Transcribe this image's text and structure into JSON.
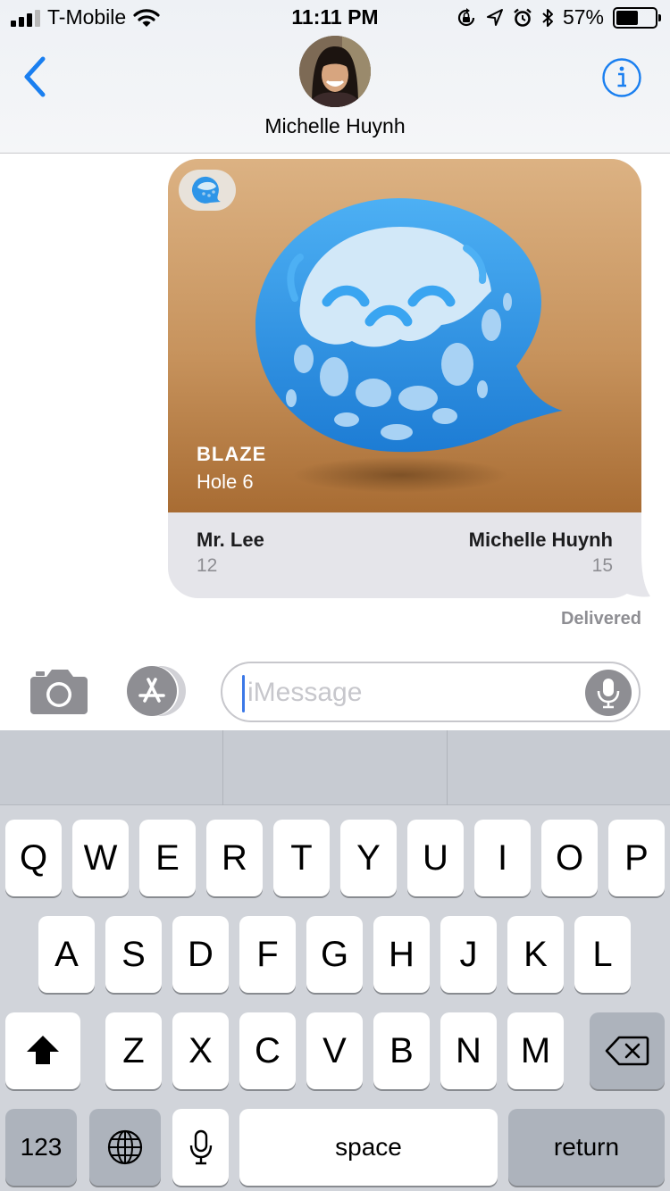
{
  "status_bar": {
    "carrier": "T-Mobile",
    "time": "11:11 PM",
    "battery": "57%",
    "battery_level": 0.57,
    "icons": [
      "signal-icon",
      "wifi-icon",
      "orientation-lock-icon",
      "location-icon",
      "alarm-icon",
      "bluetooth-icon",
      "battery-icon"
    ]
  },
  "header": {
    "contact_name": "Michelle Huynh",
    "back_icon": "chevron-left-icon",
    "info_icon": "info-icon",
    "accent": "#1a7ff0"
  },
  "message": {
    "game_title": "BLAZE",
    "game_subtitle": "Hole 6",
    "player1": {
      "name": "Mr. Lee",
      "score": "12"
    },
    "player2": {
      "name": "Michelle Huynh",
      "score": "15"
    },
    "status": "Delivered",
    "art_icon": "golf-ball-bubble-icon"
  },
  "input_bar": {
    "placeholder": "iMessage",
    "icons": [
      "camera-icon",
      "app-store-icon",
      "microphone-icon"
    ]
  },
  "keyboard": {
    "row1": [
      "Q",
      "W",
      "E",
      "R",
      "T",
      "Y",
      "U",
      "I",
      "O",
      "P"
    ],
    "row2": [
      "A",
      "S",
      "D",
      "F",
      "G",
      "H",
      "J",
      "K",
      "L"
    ],
    "row3": [
      "Z",
      "X",
      "C",
      "V",
      "B",
      "N",
      "M"
    ],
    "numbers_label": "123",
    "space_label": "space",
    "return_label": "return",
    "special_icons": [
      "shift-icon",
      "backspace-icon",
      "globe-icon",
      "dictation-icon"
    ]
  }
}
